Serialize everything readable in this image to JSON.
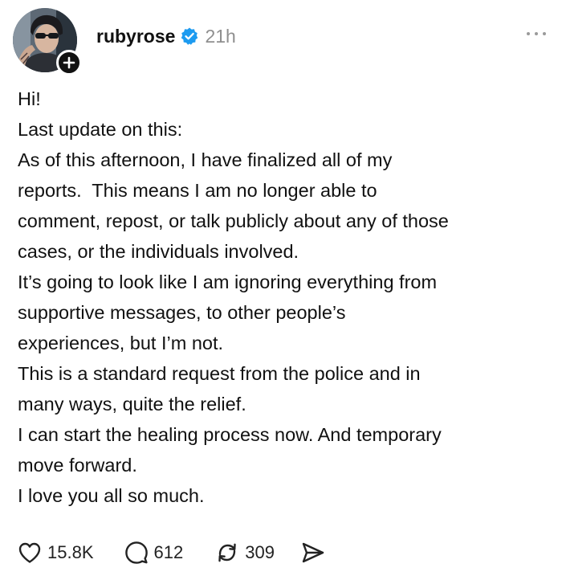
{
  "post": {
    "username": "rubyrose",
    "timestamp": "21h",
    "verified": true,
    "lines": [
      "Hi!",
      "Last update on this:",
      "As of this afternoon, I have finalized all of my",
      "reports.  This means I am no longer able to",
      "comment, repost, or talk publicly about any of those",
      "cases, or the individuals involved.",
      "It’s going to look like I am ignoring everything from",
      "supportive messages, to other people’s",
      "experiences, but I’m not.",
      "This is a standard request from the police and in",
      "many ways, quite the relief.",
      "I can start the healing process now. And temporary",
      "move forward.",
      "I love you all so much."
    ]
  },
  "actions": {
    "likes": "15.8K",
    "replies": "612",
    "reposts": "309"
  },
  "icons": {
    "verified": "verified-badge-icon",
    "more": "more-horizontal-icon",
    "like": "heart-icon",
    "reply": "comment-bubble-icon",
    "repost": "repost-icon",
    "share": "send-icon",
    "follow": "plus-icon"
  },
  "colors": {
    "verified_blue": "#1d9bf0",
    "text": "#111111",
    "muted": "#8f8f8f"
  }
}
